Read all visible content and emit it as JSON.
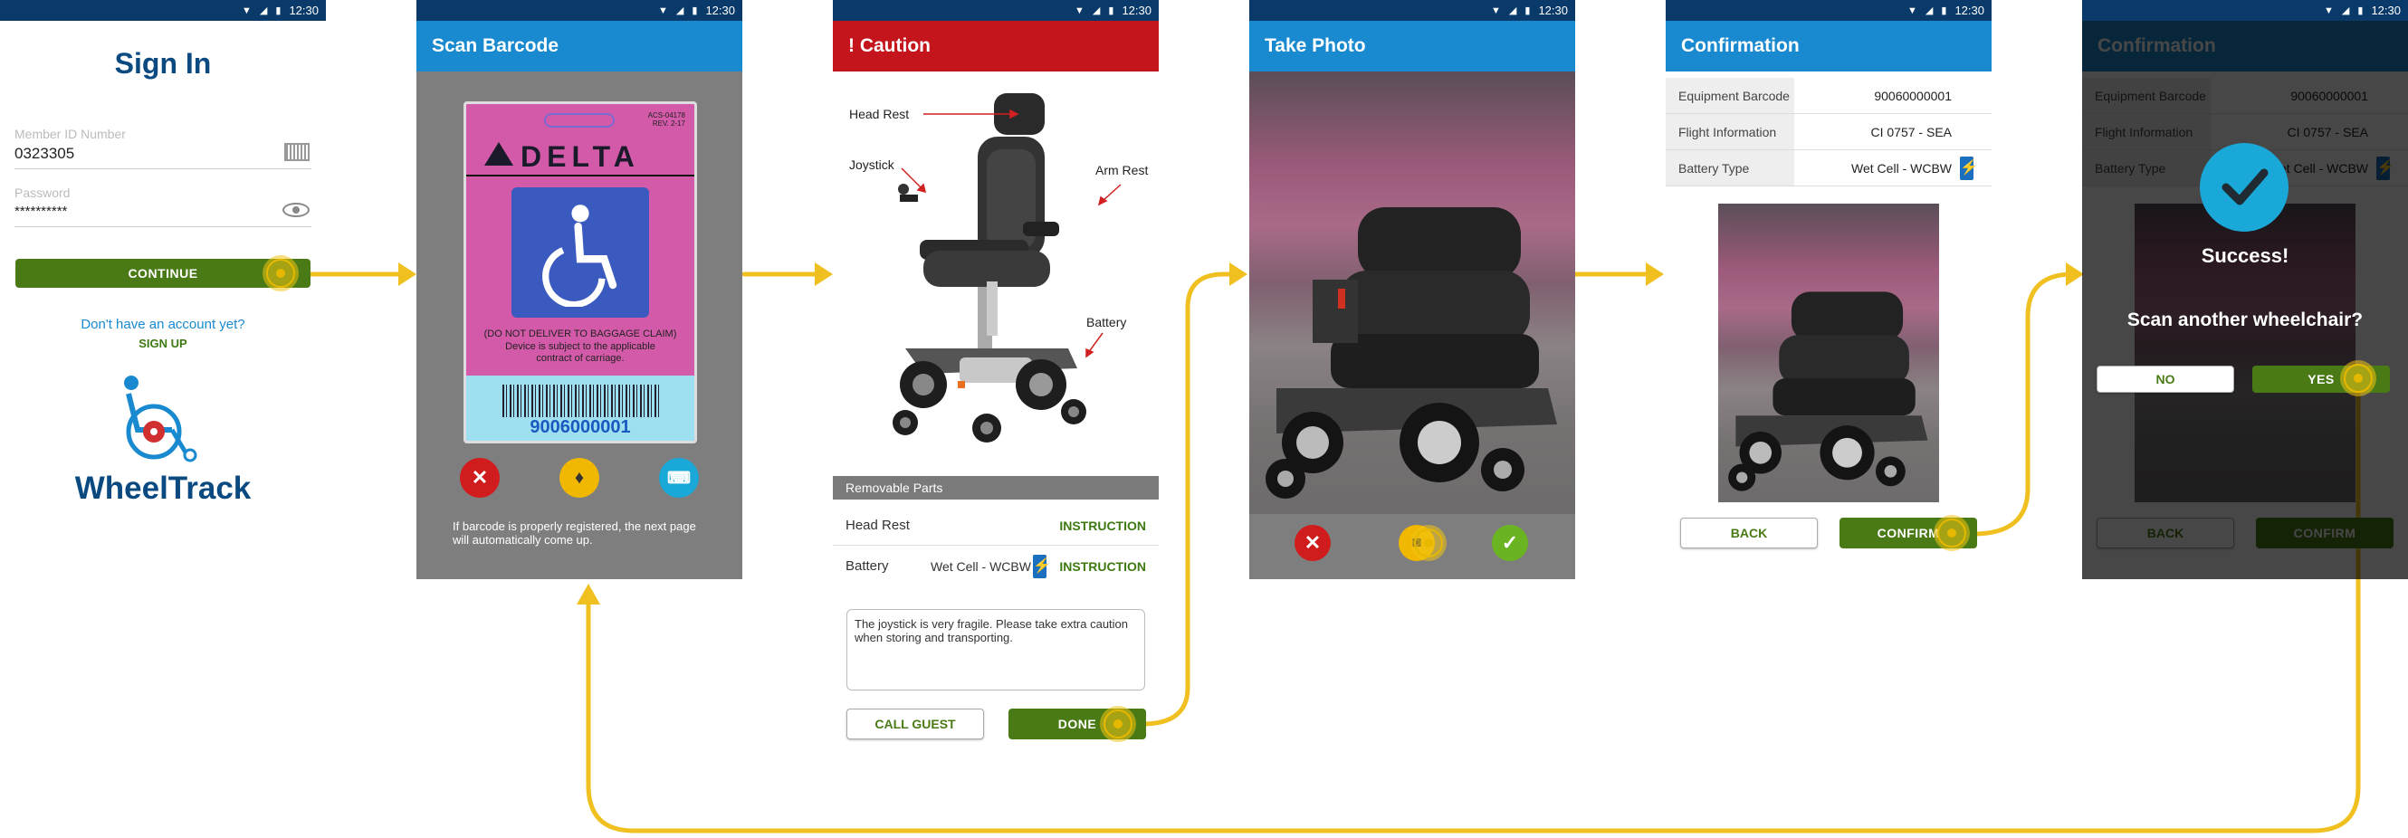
{
  "status": {
    "time": "12:30",
    "wifi_icon": "wifi-icon",
    "signal_icon": "signal-icon",
    "battery_icon": "battery-icon"
  },
  "colors": {
    "appbar_blue": "#1a8ad0",
    "appbar_red": "#c4151c",
    "status_bg": "#0a3a6a",
    "action_green": "#4a7a16",
    "flow_yellow": "#f0c020",
    "success_cyan": "#1aa8d8"
  },
  "signin": {
    "title": "Sign In",
    "member_label": "Member ID Number",
    "member_value": "0323305",
    "password_label": "Password",
    "password_value": "**********",
    "continue_label": "CONTINUE",
    "no_account": "Don't have an account yet?",
    "signup": "SIGN UP",
    "brand": "WheelTrack"
  },
  "scan": {
    "title": "Scan Barcode",
    "tag_code": "ACS-04178\nREV. 2-17",
    "tag_airline": "DELTA",
    "tag_notice_1": "(DO NOT DELIVER TO BAGGAGE CLAIM)",
    "tag_notice_2": "Device is subject to the applicable",
    "tag_notice_3": "contract of carriage.",
    "tag_barcode": "9006000001",
    "hint": "If  barcode is properly registered, the next page will automatically come up."
  },
  "caution": {
    "title": "! Caution",
    "labels": {
      "head_rest": "Head Rest",
      "joystick": "Joystick",
      "arm_rest": "Arm Rest",
      "battery": "Battery"
    },
    "section": "Removable Parts",
    "rows": [
      {
        "name": "Head Rest",
        "value": "",
        "action": "INSTRUCTION"
      },
      {
        "name": "Battery",
        "value": "Wet Cell - WCBW",
        "action": "INSTRUCTION"
      }
    ],
    "note": "The joystick is very fragile. Please take extra caution when storing and transporting.",
    "call_guest": "CALL GUEST",
    "done": "DONE"
  },
  "photo": {
    "title": "Take Photo"
  },
  "confirm": {
    "title": "Confirmation",
    "rows": [
      {
        "label": "Equipment Barcode",
        "value": "90060000001"
      },
      {
        "label": "Flight Information",
        "value": "CI 0757 - SEA"
      },
      {
        "label": "Battery Type",
        "value": "Wet Cell - WCBW"
      }
    ],
    "back": "BACK",
    "confirm": "CONFIRM"
  },
  "success": {
    "title": "Success!",
    "question": "Scan another wheelchair?",
    "no": "NO",
    "yes": "YES"
  }
}
